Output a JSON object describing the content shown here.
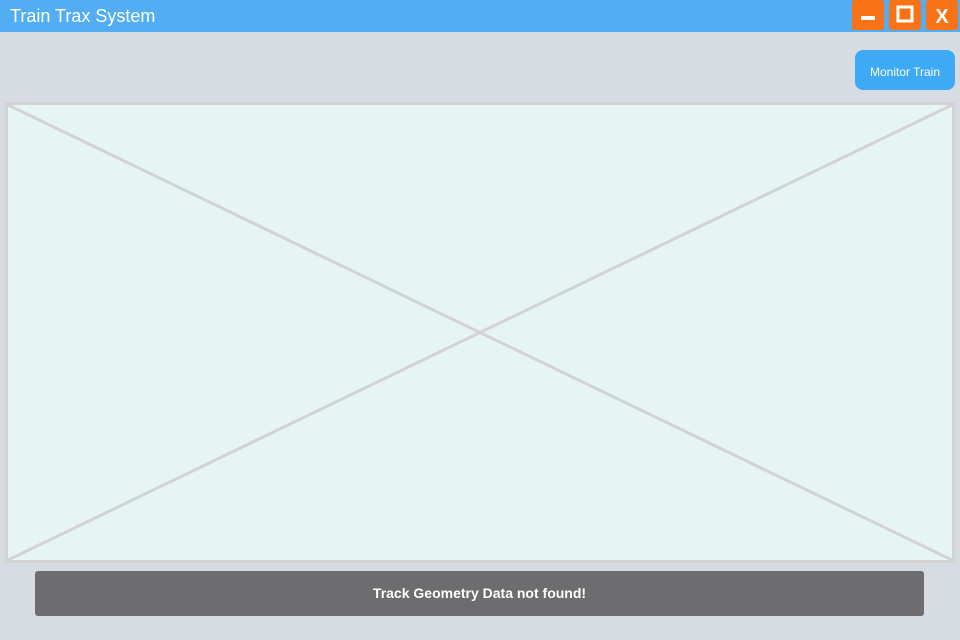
{
  "window": {
    "title": "Train Trax System",
    "title_bar_color": "#52adf2",
    "controls": {
      "minimize_icon": "minimize-icon",
      "maximize_icon": "maximize-icon",
      "close_icon": "close-icon",
      "close_label": "X",
      "color": "#f97316"
    }
  },
  "toolbar": {
    "monitor_label": "Monitor Train",
    "monitor_color": "#3ea9f5"
  },
  "viewport": {
    "placeholder_icon": "image-placeholder-icon",
    "background": "#e6f4f4"
  },
  "status": {
    "message": "Track Geometry Data not found!",
    "color": "#6d6d6f"
  }
}
